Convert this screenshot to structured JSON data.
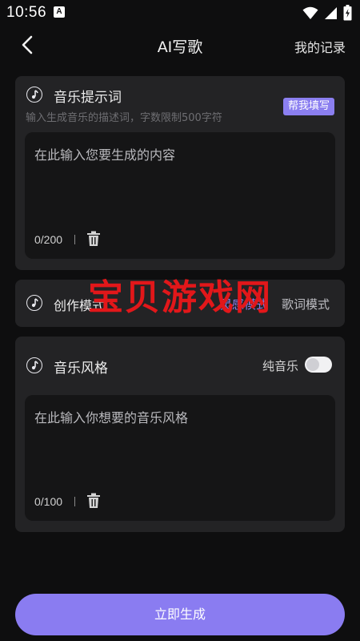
{
  "status_bar": {
    "time": "10:56",
    "notification_letter": "A"
  },
  "header": {
    "title": "AI写歌",
    "records_label": "我的记录"
  },
  "prompt_card": {
    "title": "音乐提示词",
    "subtitle": "输入生成音乐的描述词，字数限制500字符",
    "fill_button_label": "帮我填写",
    "placeholder": "在此输入您要生成的内容",
    "counter": "0/200"
  },
  "mode_card": {
    "title": "创作模式",
    "options": [
      {
        "label": "灵感模式",
        "selected": true
      },
      {
        "label": "歌词模式",
        "selected": false
      }
    ]
  },
  "style_card": {
    "title": "音乐风格",
    "toggle_label": "纯音乐",
    "toggle_on": false,
    "placeholder": "在此输入你想要的音乐风格",
    "counter": "0/100"
  },
  "watermark": "宝贝游戏网",
  "generate_button_label": "立即生成",
  "colors": {
    "background": "#0e0e0f",
    "card": "#232325",
    "accent": "#8a7cf1",
    "selected_option": "#8b7ff0",
    "unselected_option": "#bdbdc2",
    "watermark": "#e2171a"
  },
  "icons": [
    "back-arrow-icon",
    "music-note-icon",
    "trash-icon",
    "wifi-icon",
    "signal-icon",
    "battery-icon"
  ]
}
